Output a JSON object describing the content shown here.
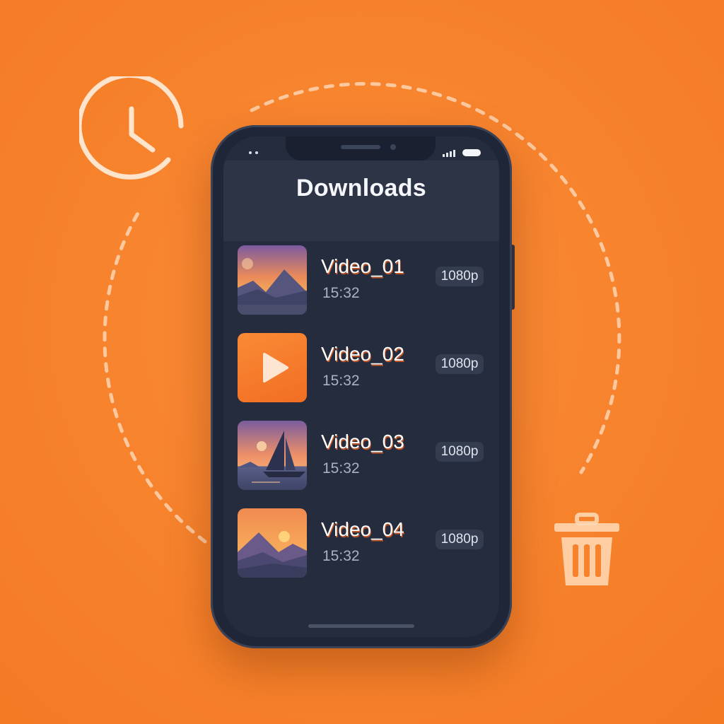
{
  "screen": {
    "title": "Downloads"
  },
  "videos": [
    {
      "title": "Video_01",
      "duration": "15:32",
      "quality": "1080p",
      "thumbnail": "mountain-sunset"
    },
    {
      "title": "Video_02",
      "duration": "15:32",
      "quality": "1080p",
      "thumbnail": "play-icon"
    },
    {
      "title": "Video_03",
      "duration": "15:32",
      "quality": "1080p",
      "thumbnail": "sailboat-sunset"
    },
    {
      "title": "Video_04",
      "duration": "15:32",
      "quality": "1080p",
      "thumbnail": "mountain-dusk"
    }
  ],
  "decorations": {
    "top_left": "clock-icon",
    "bottom_right": "trash-icon"
  },
  "colors": {
    "background": "#f7822c",
    "phone_body": "#1f2637",
    "screen": "#242c3d",
    "accent": "#f77a2a"
  }
}
